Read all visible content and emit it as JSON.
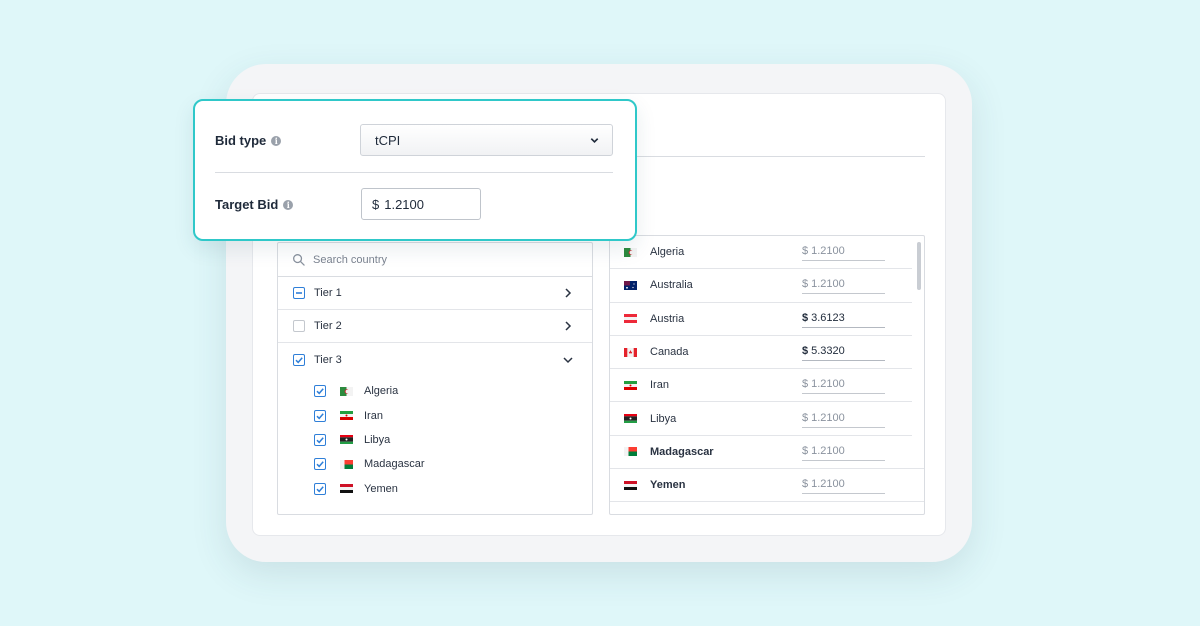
{
  "bid_card": {
    "bid_type_label": "Bid type",
    "bid_type_value": "tCPI",
    "target_bid_label": "Target Bid",
    "target_bid_currency": "$",
    "target_bid_value": "1.2100",
    "info_glyph": "i"
  },
  "country_picker": {
    "search_placeholder": "Search country",
    "tiers": [
      {
        "label": "Tier 1",
        "state": "partial",
        "expanded": false
      },
      {
        "label": "Tier 2",
        "state": "unchecked",
        "expanded": false
      },
      {
        "label": "Tier 3",
        "state": "checked",
        "expanded": true
      }
    ],
    "tier3_countries": [
      {
        "name": "Algeria",
        "checked": true,
        "flag": "algeria-flag-icon"
      },
      {
        "name": "Iran",
        "checked": true,
        "flag": "iran-flag-icon"
      },
      {
        "name": "Libya",
        "checked": true,
        "flag": "libya-flag-icon"
      },
      {
        "name": "Madagascar",
        "checked": true,
        "flag": "madagascar-flag-icon"
      },
      {
        "name": "Yemen",
        "checked": true,
        "flag": "yemen-flag-icon"
      }
    ]
  },
  "bid_list": {
    "rows": [
      {
        "country": "Algeria",
        "currency": "$",
        "bid": "1.2100",
        "custom": false,
        "bold": false
      },
      {
        "country": "Australia",
        "currency": "$",
        "bid": "1.2100",
        "custom": false,
        "bold": false
      },
      {
        "country": "Austria",
        "currency": "$",
        "bid": "3.6123",
        "custom": true,
        "bold": false
      },
      {
        "country": "Canada",
        "currency": "$",
        "bid": "5.3320",
        "custom": true,
        "bold": false
      },
      {
        "country": "Iran",
        "currency": "$",
        "bid": "1.2100",
        "custom": false,
        "bold": false
      },
      {
        "country": "Libya",
        "currency": "$",
        "bid": "1.2100",
        "custom": false,
        "bold": false
      },
      {
        "country": "Madagascar",
        "currency": "$",
        "bid": "1.2100",
        "custom": false,
        "bold": true
      },
      {
        "country": "Yemen",
        "currency": "$",
        "bid": "1.2100",
        "custom": false,
        "bold": true
      }
    ]
  },
  "colors": {
    "background": "#dff7f9",
    "card_border": "#2fc8c9",
    "checkbox_accent": "#2f7fd8"
  }
}
